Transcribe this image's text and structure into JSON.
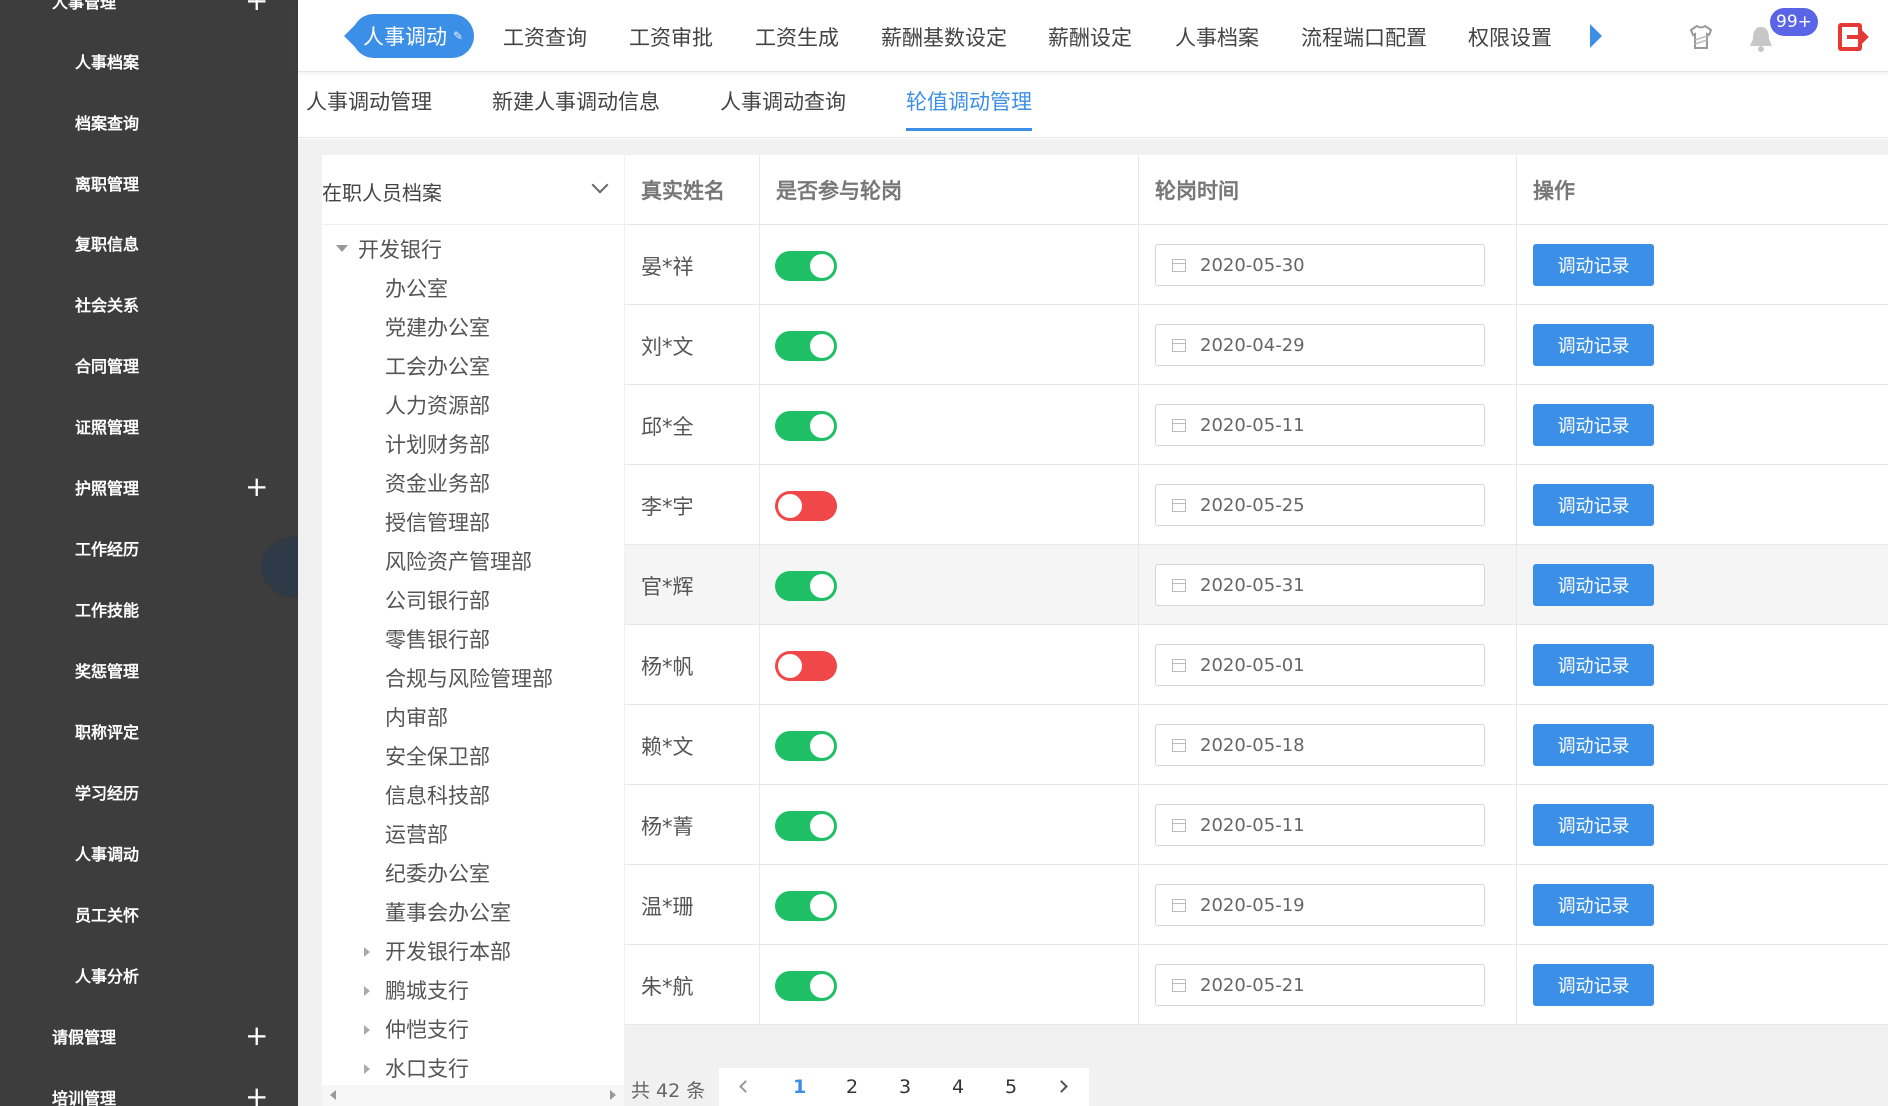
{
  "sidebar": {
    "items": [
      {
        "label": "人事管理",
        "plus": "+"
      },
      {
        "label": "人事档案"
      },
      {
        "label": "档案查询"
      },
      {
        "label": "离职管理"
      },
      {
        "label": "复职信息"
      },
      {
        "label": "社会关系"
      },
      {
        "label": "合同管理"
      },
      {
        "label": "证照管理"
      },
      {
        "label": "护照管理",
        "plus": "+"
      },
      {
        "label": "工作经历"
      },
      {
        "label": "工作技能"
      },
      {
        "label": "奖惩管理"
      },
      {
        "label": "职称评定"
      },
      {
        "label": "学习经历"
      },
      {
        "label": "人事调动"
      },
      {
        "label": "员工关怀"
      },
      {
        "label": "人事分析"
      },
      {
        "label": "请假管理",
        "plus": "+"
      },
      {
        "label": "培训管理",
        "plus": "+"
      }
    ]
  },
  "topnav": {
    "active": "人事调动",
    "items": [
      "工资查询",
      "工资审批",
      "工资生成",
      "薪酬基数设定",
      "薪酬设定",
      "人事档案",
      "流程端口配置",
      "权限设置"
    ],
    "badge": "99+",
    "icons": [
      "skin-icon",
      "bell-icon",
      "logout-icon"
    ],
    "accent": "#3c8fe7"
  },
  "subtabs": {
    "items": [
      "人事调动管理",
      "新建人事调动信息",
      "人事调动查询",
      "轮值调动管理"
    ],
    "active_index": 3
  },
  "tree": {
    "header": "在职人员档案",
    "root": "开发银行",
    "children": [
      "办公室",
      "党建办公室",
      "工会办公室",
      "人力资源部",
      "计划财务部",
      "资金业务部",
      "授信管理部",
      "风险资产管理部",
      "公司银行部",
      "零售银行部",
      "合规与风险管理部",
      "内审部",
      "安全保卫部",
      "信息科技部",
      "运营部",
      "纪委办公室",
      "董事会办公室"
    ],
    "collapsed": [
      "开发银行本部",
      "鹏城支行",
      "仲恺支行",
      "水口支行"
    ]
  },
  "table": {
    "headers": [
      "真实姓名",
      "是否参与轮岗",
      "轮岗时间",
      "操作"
    ],
    "action_label": "调动记录",
    "rows": [
      {
        "name": "晏*祥",
        "rotation": true,
        "date": "2020-05-30"
      },
      {
        "name": "刘*文",
        "rotation": true,
        "date": "2020-04-29"
      },
      {
        "name": "邱*全",
        "rotation": true,
        "date": "2020-05-11"
      },
      {
        "name": "李*宇",
        "rotation": false,
        "date": "2020-05-25"
      },
      {
        "name": "官*辉",
        "rotation": true,
        "date": "2020-05-31"
      },
      {
        "name": "杨*帆",
        "rotation": false,
        "date": "2020-05-01"
      },
      {
        "name": "赖*文",
        "rotation": true,
        "date": "2020-05-18"
      },
      {
        "name": "杨*菁",
        "rotation": true,
        "date": "2020-05-11"
      },
      {
        "name": "温*珊",
        "rotation": true,
        "date": "2020-05-19"
      },
      {
        "name": "朱*航",
        "rotation": true,
        "date": "2020-05-21"
      }
    ]
  },
  "pagination": {
    "total": "共 42 条",
    "pages": [
      "1",
      "2",
      "3",
      "4",
      "5"
    ],
    "current": "1"
  }
}
